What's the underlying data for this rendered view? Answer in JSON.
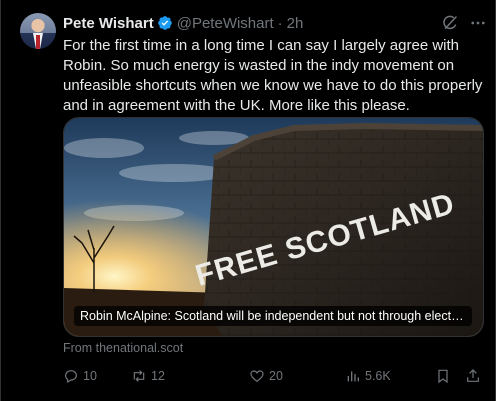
{
  "tweet": {
    "author_name": "Pete Wishart",
    "handle": "@PeteWishart",
    "separator": "·",
    "time": "2h",
    "text": "For the first time in a long time I can say I largely agree with Robin. So much energy is wasted in the indy movement on unfeasible shortcuts when we know we have to do this properly and in agreement with the UK. More like this please."
  },
  "card": {
    "title": "Robin McAlpine: Scotland will be independent but not through elector...",
    "image_text": "FREE SCOTLAND",
    "source": "From thenational.scot"
  },
  "actions": {
    "replies": "10",
    "reposts": "12",
    "likes": "20",
    "views": "5.6K"
  },
  "icons": {
    "verified": "verified-badge-icon",
    "grok": "grok-icon",
    "more": "more-icon",
    "reply": "reply-icon",
    "repost": "repost-icon",
    "like": "heart-icon",
    "views": "views-icon",
    "bookmark": "bookmark-icon",
    "share": "share-icon"
  },
  "colors": {
    "background": "#000000",
    "text_primary": "#e7e9ea",
    "text_secondary": "#71767b",
    "verified_blue": "#1d9bf0"
  }
}
